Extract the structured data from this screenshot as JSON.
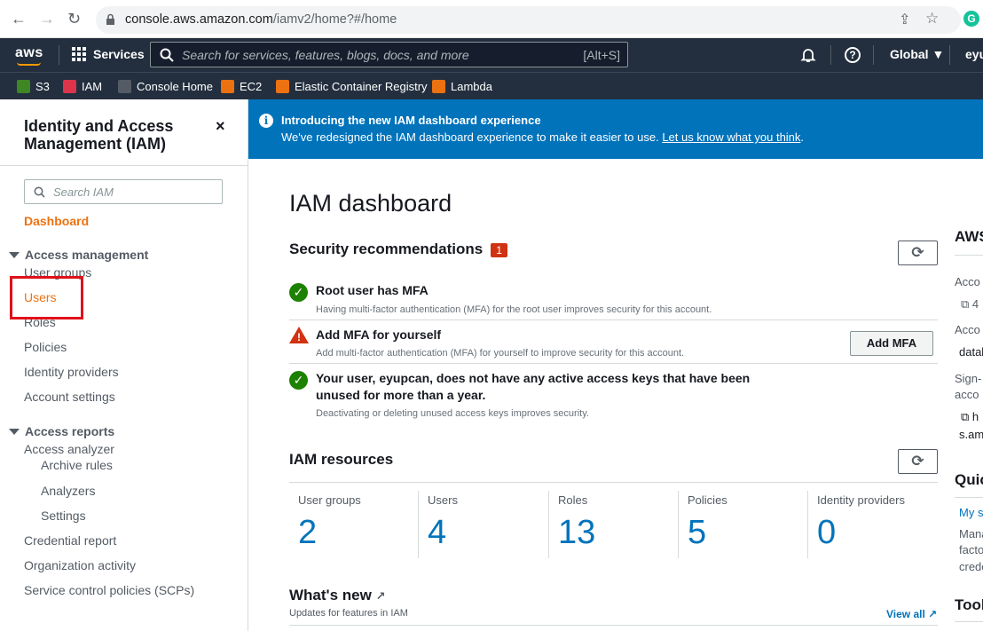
{
  "browser": {
    "back": "←",
    "forward": "→",
    "reload": "↻",
    "url_host": "console.aws.amazon.com",
    "url_path": "/iamv2/home?#/home",
    "share_icon": "⇪",
    "star_icon": "☆",
    "extension": "G"
  },
  "topnav": {
    "logo": "aws",
    "services": "Services",
    "search_placeholder": "Search for services, features, blogs, docs, and more",
    "search_shortcut": "[Alt+S]",
    "bell_icon": "🔔",
    "help_icon": "?",
    "region": "Global ▼",
    "account": "eyu"
  },
  "favorites": [
    {
      "label": "S3",
      "color": "#3f8624"
    },
    {
      "label": "IAM",
      "color": "#dd344c"
    },
    {
      "label": "Console Home",
      "color": "#545b64"
    },
    {
      "label": "EC2",
      "color": "#ec7211"
    },
    {
      "label": "Elastic Container Registry",
      "color": "#ec7211"
    },
    {
      "label": "Lambda",
      "color": "#ec7211"
    }
  ],
  "sidebar": {
    "title": "Identity and Access Management (IAM)",
    "close": "×",
    "search_placeholder": "Search IAM",
    "dashboard": "Dashboard",
    "access_management": "Access management",
    "user_groups": "User groups",
    "users": "Users",
    "roles": "Roles",
    "policies": "Policies",
    "identity_providers": "Identity providers",
    "account_settings": "Account settings",
    "access_reports": "Access reports",
    "access_analyzer": "Access analyzer",
    "archive_rules": "Archive rules",
    "analyzers": "Analyzers",
    "settings": "Settings",
    "credential_report": "Credential report",
    "organization_activity": "Organization activity",
    "scps": "Service control policies (SCPs)"
  },
  "banner": {
    "title": "Introducing the new IAM dashboard experience",
    "text": "We've redesigned the IAM dashboard experience to make it easier to use. ",
    "link": "Let us know what you think",
    "end": "."
  },
  "main": {
    "page_title": "IAM dashboard",
    "security_title": "Security recommendations",
    "security_count": "1",
    "recommendations": [
      {
        "title": "Root user has MFA",
        "desc": "Having multi-factor authentication (MFA) for the root user improves security for this account.",
        "status": "ok"
      },
      {
        "title": "Add MFA for yourself",
        "desc": "Add multi-factor authentication (MFA) for yourself to improve security for this account.",
        "status": "warning"
      },
      {
        "title": "Your user, eyupcan, does not have any active access keys that have been unused for more than a year.",
        "desc": "Deactivating or deleting unused access keys improves security.",
        "status": "ok"
      }
    ],
    "add_mfa": "Add MFA",
    "resources_title": "IAM resources",
    "resources": [
      {
        "label": "User groups",
        "value": "2"
      },
      {
        "label": "Users",
        "value": "4"
      },
      {
        "label": "Roles",
        "value": "13"
      },
      {
        "label": "Policies",
        "value": "5"
      },
      {
        "label": "Identity providers",
        "value": "0"
      }
    ],
    "whats_new": "What's new",
    "whats_new_sub": "Updates for features in IAM",
    "view_all": "View all",
    "refresh_icon": "⟳",
    "external_icon": "↗"
  },
  "right_panel": {
    "heading1": "AWS",
    "acc1": "Acco",
    "acc1_val": "4",
    "acc2": "Acco",
    "acc2_val": "datal",
    "signin": "Sign-",
    "signin2": "acco",
    "signin_url": "h",
    "signin_url2": "s.am",
    "heading2": "Quic",
    "link1": "My s",
    "text1": "Mana",
    "text2": "facto",
    "text3": "crede",
    "heading3": "Tool"
  }
}
